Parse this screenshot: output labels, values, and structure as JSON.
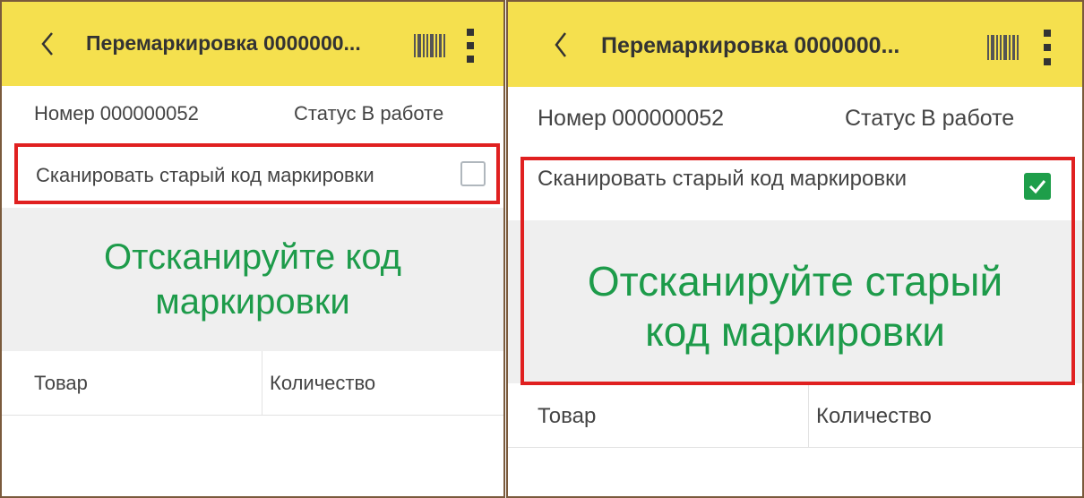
{
  "screens": [
    {
      "title": "Перемаркировка 0000000...",
      "number_label": "Номер",
      "number_value": "000000052",
      "status_label": "Статус",
      "status_value": "В работе",
      "scan_old_label": "Сканировать старый код маркировки",
      "scan_old_checked": false,
      "prompt_line1": "Отсканируйте код",
      "prompt_line2": "маркировки",
      "col_goods": "Товар",
      "col_qty": "Количество"
    },
    {
      "title": "Перемаркировка 0000000...",
      "number_label": "Номер",
      "number_value": "000000052",
      "status_label": "Статус",
      "status_value": "В работе",
      "scan_old_label": "Сканировать старый код маркировки",
      "scan_old_checked": true,
      "prompt_line1": "Отсканируйте старый",
      "prompt_line2": "код маркировки",
      "col_goods": "Товар",
      "col_qty": "Количество"
    }
  ],
  "colors": {
    "header_bg": "#f5e04e",
    "accent_green": "#1d9b4a",
    "highlight_red": "#e02020",
    "panel_bg": "#efefef"
  },
  "icons": [
    "chevron-left-icon",
    "barcode-icon",
    "more-vertical-icon",
    "checkbox-icon",
    "checkmark-icon"
  ]
}
